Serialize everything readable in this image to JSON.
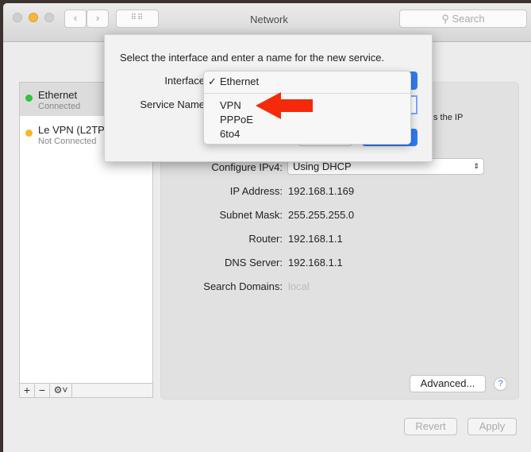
{
  "window": {
    "title": "Network",
    "search_placeholder": "Search"
  },
  "services": [
    {
      "name": "Ethernet",
      "status": "Connected",
      "color": "#2ec53a",
      "selected": true
    },
    {
      "name": "Le VPN (L2TP",
      "status": "Not Connected",
      "color": "#f5b728",
      "selected": false
    }
  ],
  "list_toolbar": {
    "add": "+",
    "remove": "−",
    "gear": "⚙˅"
  },
  "details": {
    "configure_label": "Configure IPv4:",
    "configure_value": "Using DHCP",
    "ip_label": "IP Address:",
    "ip": "192.168.1.169",
    "subnet_label": "Subnet Mask:",
    "subnet": "255.255.255.0",
    "router_label": "Router:",
    "router": "192.168.1.1",
    "dns_label": "DNS Server:",
    "dns": "192.168.1.1",
    "domains_label": "Search Domains:",
    "domains_placeholder": "local",
    "partial_text": "s the IP"
  },
  "buttons": {
    "advanced": "Advanced...",
    "help": "?",
    "revert": "Revert",
    "apply": "Apply"
  },
  "sheet": {
    "prompt": "Select the interface and enter a name for the new service.",
    "interface_label": "Interface",
    "service_name_label": "Service Name",
    "menu": {
      "checked": "✓",
      "items": [
        "Ethernet",
        "VPN",
        "PPPoE",
        "6to4"
      ]
    }
  },
  "colors": {
    "arrow": "#f52a0a",
    "accent": "#2f7cf0"
  }
}
